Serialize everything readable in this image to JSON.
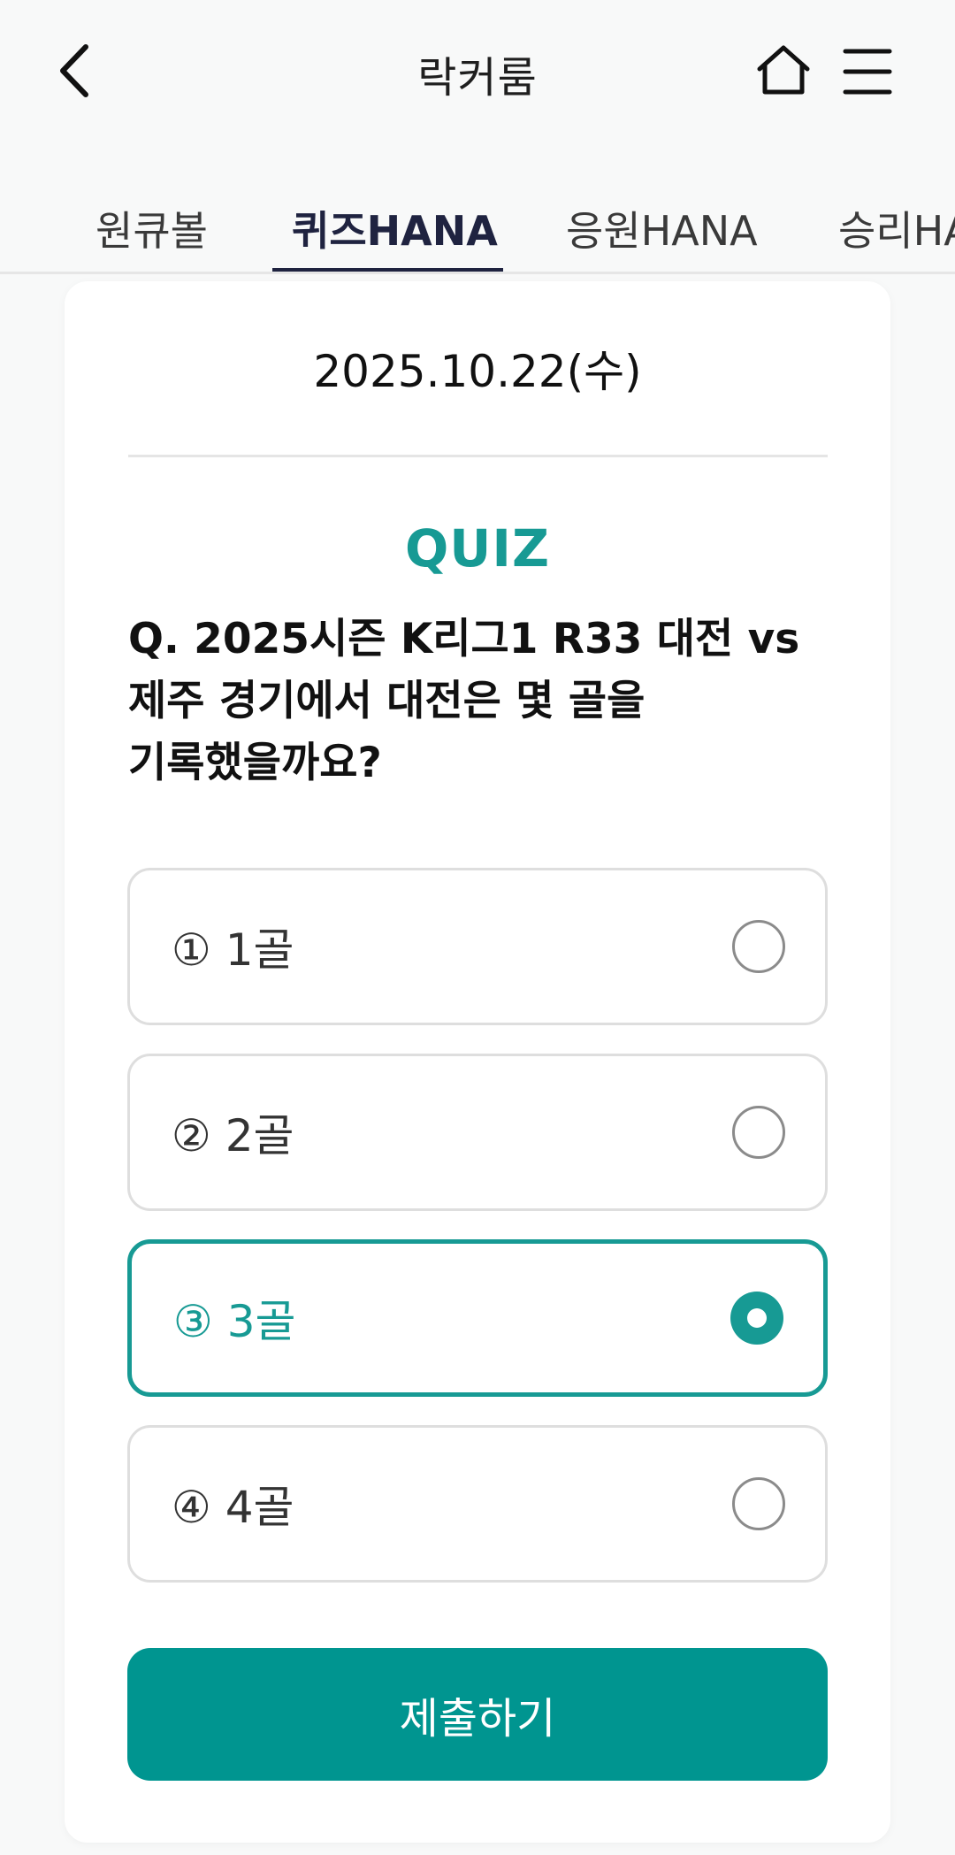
{
  "header": {
    "title": "락커룸"
  },
  "tabs": [
    {
      "label": "원큐볼",
      "active": false
    },
    {
      "label": "퀴즈HANA",
      "active": true
    },
    {
      "label": "응원HANA",
      "active": false
    },
    {
      "label": "승리HANA",
      "active": false
    }
  ],
  "quiz": {
    "date": "2025.10.22(수)",
    "section_label": "QUIZ",
    "question": "Q. 2025시즌 K리그1 R33 대전 vs 제주 경기에서 대전은 몇 골을 기록했을까요?",
    "options": [
      {
        "label": "① 1골",
        "selected": false
      },
      {
        "label": "② 2골",
        "selected": false
      },
      {
        "label": "③ 3골",
        "selected": true
      },
      {
        "label": "④ 4골",
        "selected": false
      }
    ],
    "submit_label": "제출하기"
  },
  "colors": {
    "accent": "#179a94",
    "button": "#009590",
    "tab_active": "#1f2340"
  },
  "icons": {
    "back": "chevron-left-icon",
    "home": "home-icon",
    "menu": "hamburger-menu-icon"
  }
}
